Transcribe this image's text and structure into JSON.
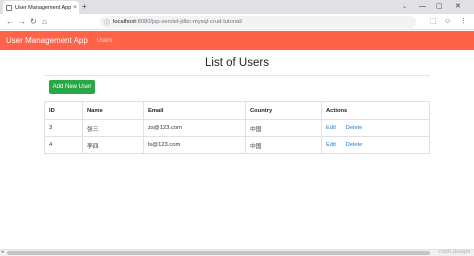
{
  "browser": {
    "tab_title": "User Management Applicati",
    "tab_close": "×",
    "new_tab": "+",
    "tab_list": "⌄",
    "win_min": "—",
    "win_max": "▢",
    "win_close": "✕",
    "back": "←",
    "forward": "→",
    "reload": "↻",
    "home": "⌂",
    "url_icon": "ⓘ",
    "url_host": "localhost",
    "url_path": ":8080/jsp-servlet-jdbc-mysql-crud-tutorial/",
    "icon_extensions": "⬚",
    "icon_profile": "☺",
    "icon_menu": "⋮"
  },
  "app": {
    "brand": "User Management App",
    "nav_link": "Users"
  },
  "main": {
    "title": "List of Users",
    "add_button": "Add New User"
  },
  "table": {
    "headers": [
      "ID",
      "Name",
      "Email",
      "Country",
      "Actions"
    ],
    "rows": [
      {
        "id": "3",
        "name": "张三",
        "email": "zs@123.com",
        "country": "中国",
        "edit": "Edit",
        "delete": "Delete"
      },
      {
        "id": "4",
        "name": "李四",
        "email": "ls@123.com",
        "country": "中国",
        "edit": "Edit",
        "delete": "Delete"
      }
    ]
  },
  "scrollbar": {
    "arrow_left": "◂",
    "watermark": "CSDN @xdsj19"
  },
  "colors": {
    "brand_bar": "#ff6347",
    "add_button": "#28a745",
    "link": "#1e7ed4"
  }
}
